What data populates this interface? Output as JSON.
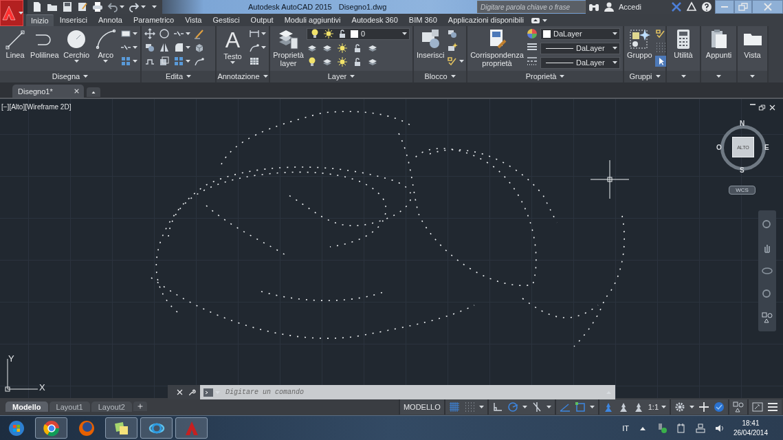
{
  "title_bar": {
    "app_title": "Autodesk AutoCAD 2015",
    "document": "Disegno1.dwg",
    "search": {
      "placeholder": "Digitare parola chiave o frase"
    },
    "sign_in": "Accedi"
  },
  "ribbon_tabs": [
    {
      "label": "Inizio",
      "selected": true
    },
    {
      "label": "Inserisci",
      "selected": false
    },
    {
      "label": "Annota",
      "selected": false
    },
    {
      "label": "Parametrico",
      "selected": false
    },
    {
      "label": "Vista",
      "selected": false
    },
    {
      "label": "Gestisci",
      "selected": false
    },
    {
      "label": "Output",
      "selected": false
    },
    {
      "label": "Moduli aggiuntivi",
      "selected": false
    },
    {
      "label": "Autodesk 360",
      "selected": false
    },
    {
      "label": "BIM 360",
      "selected": false
    },
    {
      "label": "Applicazioni disponibili",
      "selected": false
    }
  ],
  "ribbon_panels": [
    {
      "kind": "draw",
      "title": "Disegna",
      "tools": [
        {
          "label": "Linea",
          "menu": false
        },
        {
          "label": "Polilinea",
          "menu": false
        },
        {
          "label": "Cerchio",
          "menu": true
        },
        {
          "label": "Arco",
          "menu": true
        }
      ]
    },
    {
      "kind": "edit",
      "title": "Edita"
    },
    {
      "kind": "annotate",
      "title": "Annotazione",
      "tools": [
        {
          "label": "Testo",
          "glyph": "A",
          "menu": true
        }
      ]
    },
    {
      "kind": "layer",
      "title": "Layer",
      "tools": [
        {
          "label": "Proprietà layer",
          "menu": false
        }
      ],
      "combos": [
        {
          "kind": "layer",
          "value": "0"
        }
      ]
    },
    {
      "kind": "block",
      "title": "Blocco",
      "tools": [
        {
          "label": "Inserisci",
          "menu": false
        }
      ]
    },
    {
      "kind": "properties",
      "title": "Proprietà",
      "tools": [
        {
          "label": "Corrispondenza proprietà",
          "menu": false
        }
      ],
      "combos": [
        {
          "kind": "color",
          "value": "DaLayer"
        },
        {
          "kind": "linetype",
          "value": "DaLayer"
        },
        {
          "kind": "linetype",
          "value": "DaLayer"
        }
      ]
    },
    {
      "kind": "groups",
      "title": "Gruppi",
      "tools": [
        {
          "label": "Gruppo",
          "menu": false
        }
      ]
    },
    {
      "kind": "utility",
      "tools": [
        {
          "label": "Utilità",
          "menu": false
        }
      ]
    },
    {
      "kind": "clipboard",
      "tools": [
        {
          "label": "Appunti",
          "menu": false
        }
      ]
    },
    {
      "kind": "view",
      "tools": [
        {
          "label": "Vista",
          "menu": false
        }
      ]
    }
  ],
  "document_tabs": [
    {
      "label": "Disegno1*",
      "selected": true
    }
  ],
  "viewport": {
    "label": "[−][Alto][Wireframe 2D]",
    "nav_cube": {
      "face": "ALTO",
      "north": "N",
      "south": "S",
      "east": "E",
      "west": "O",
      "ucs_button": "WCS"
    },
    "ucs_axes": {
      "y": "Y",
      "x": "X"
    }
  },
  "command_line": {
    "placeholder": "Digitare un comando"
  },
  "layout_tabs": [
    {
      "label": "Modello",
      "selected": true
    },
    {
      "label": "Layout1",
      "selected": false
    },
    {
      "label": "Layout2",
      "selected": false
    }
  ],
  "status_bar": {
    "space": "MODELLO",
    "scale": "1:1"
  },
  "taskbar": {
    "language": "IT",
    "time": "18:41",
    "date": "26/04/2014"
  }
}
